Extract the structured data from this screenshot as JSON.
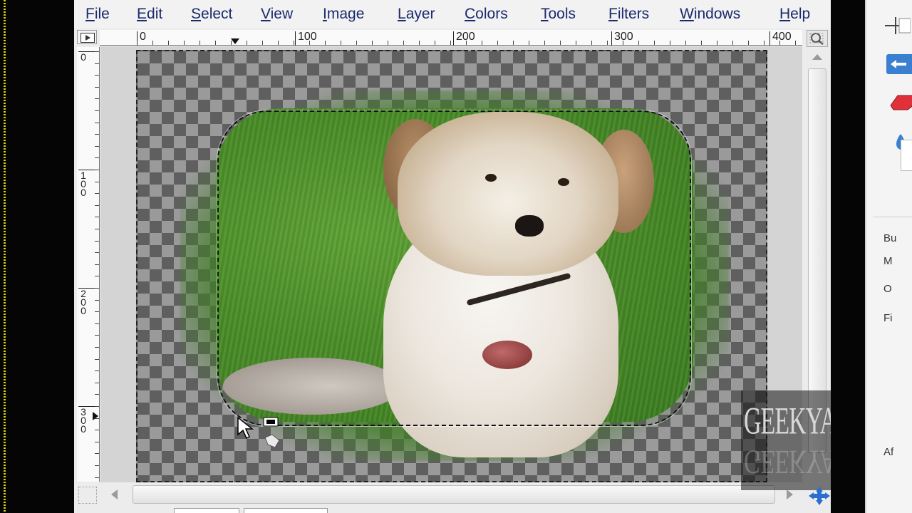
{
  "menubar": {
    "file": "File",
    "edit": "Edit",
    "select": "Select",
    "view": "View",
    "image": "Image",
    "layer": "Layer",
    "colors": "Colors",
    "tools": "Tools",
    "filters": "Filters",
    "windows": "Windows",
    "help": "Help"
  },
  "ruler_h": {
    "labels": [
      "0",
      "100",
      "200",
      "300",
      "400"
    ]
  },
  "ruler_v": {
    "labels": [
      "0",
      "100",
      "200",
      "300"
    ]
  },
  "watermark": {
    "text": "GEEKYARTIST"
  },
  "toolbox": {
    "labels": [
      "Bu",
      "M",
      "O",
      "Fi",
      "Af"
    ]
  },
  "colors": {
    "menu_text": "#1a2a6c",
    "checker_dark": "#5f5f5f",
    "checker_light": "#9a9a9a",
    "grass": "#4a8d27",
    "active_tool": "#3a7fd0"
  },
  "icons": {
    "ruler_corner": "triangle-right-icon",
    "zoom": "magnifier-icon",
    "navigate": "navigate-icon",
    "move": "move-arrows-icon",
    "pointer": "mouse-pointer-icon"
  }
}
